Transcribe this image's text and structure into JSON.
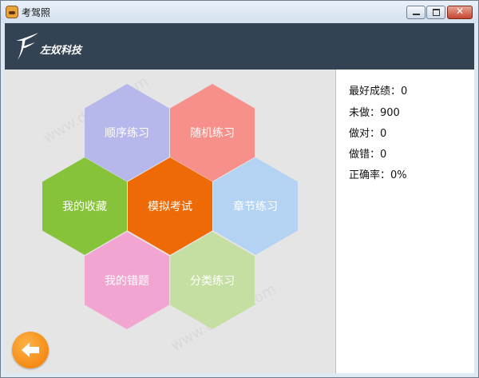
{
  "window": {
    "title": "考驾照",
    "close_glyph": "✕"
  },
  "banner": {
    "company": "左奴科技"
  },
  "menu": {
    "sequential": "顺序练习",
    "random": "随机练习",
    "favorites": "我的收藏",
    "mock_exam": "模拟考试",
    "chapter": "章节练习",
    "mistakes": "我的错题",
    "category": "分类练习"
  },
  "stats": {
    "best_score": "最好成绩：0",
    "not_done": "未做：900",
    "correct": "做对：0",
    "wrong": "做错：0",
    "accuracy": "正确率：0%"
  },
  "colors": {
    "sequential": "#b6b7ea",
    "random": "#f7908a",
    "favorites": "#86c23a",
    "mock_exam": "#ee6a06",
    "chapter": "#b4d3f3",
    "mistakes": "#f3a5d1",
    "category": "#c5dfa3",
    "banner": "#334354"
  },
  "icons": {
    "app": "car-icon",
    "logo": "company-logo-icon",
    "back": "arrow-left-icon"
  }
}
